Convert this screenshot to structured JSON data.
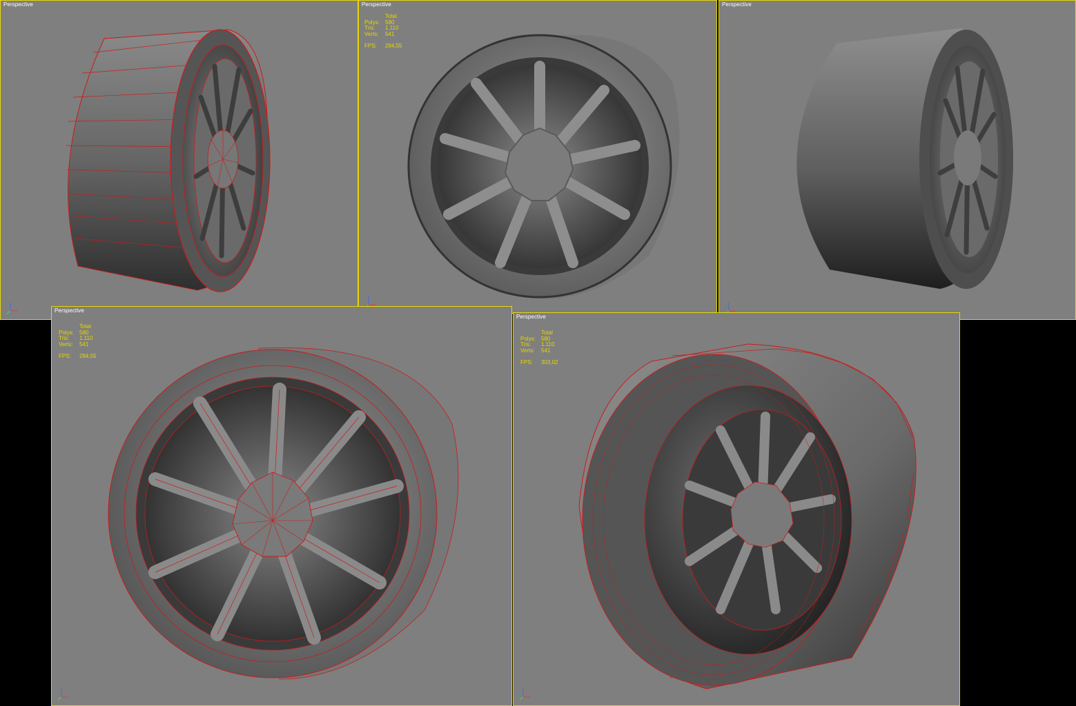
{
  "colors": {
    "viewport_bg": "#7f7f7f",
    "active_border": "#e8d800",
    "wireframe": "#cc1a1a",
    "stats_text": "#e8d800",
    "label_text": "#ffffff",
    "background": "#000000"
  },
  "viewports": [
    {
      "label": "Perspective",
      "wireframe": true
    },
    {
      "label": "Perspective",
      "stats": {
        "header": "Total",
        "polys_label": "Polys:",
        "polys": "580",
        "tris_label": "Tris:",
        "tris": "1.110",
        "verts_label": "Verts:",
        "verts": "541",
        "fps_label": "FPS:",
        "fps": "284,55"
      },
      "wireframe": false
    },
    {
      "label": "Perspective",
      "wireframe": false
    },
    {
      "label": "Perspective",
      "stats": {
        "header": "Total",
        "polys_label": "Polys:",
        "polys": "580",
        "tris_label": "Tris:",
        "tris": "1.110",
        "verts_label": "Verts:",
        "verts": "541",
        "fps_label": "FPS:",
        "fps": "284,55"
      },
      "wireframe": true
    },
    {
      "label": "Perspective",
      "stats": {
        "header": "Total",
        "polys_label": "Polys:",
        "polys": "580",
        "tris_label": "Tris:",
        "tris": "1.110",
        "verts_label": "Verts:",
        "verts": "541",
        "fps_label": "FPS:",
        "fps": "303,02"
      },
      "wireframe": true
    }
  ],
  "axis_labels": {
    "z": "z",
    "x": "x",
    "y": "y"
  },
  "icons": [
    "axis-tripod-icon"
  ]
}
